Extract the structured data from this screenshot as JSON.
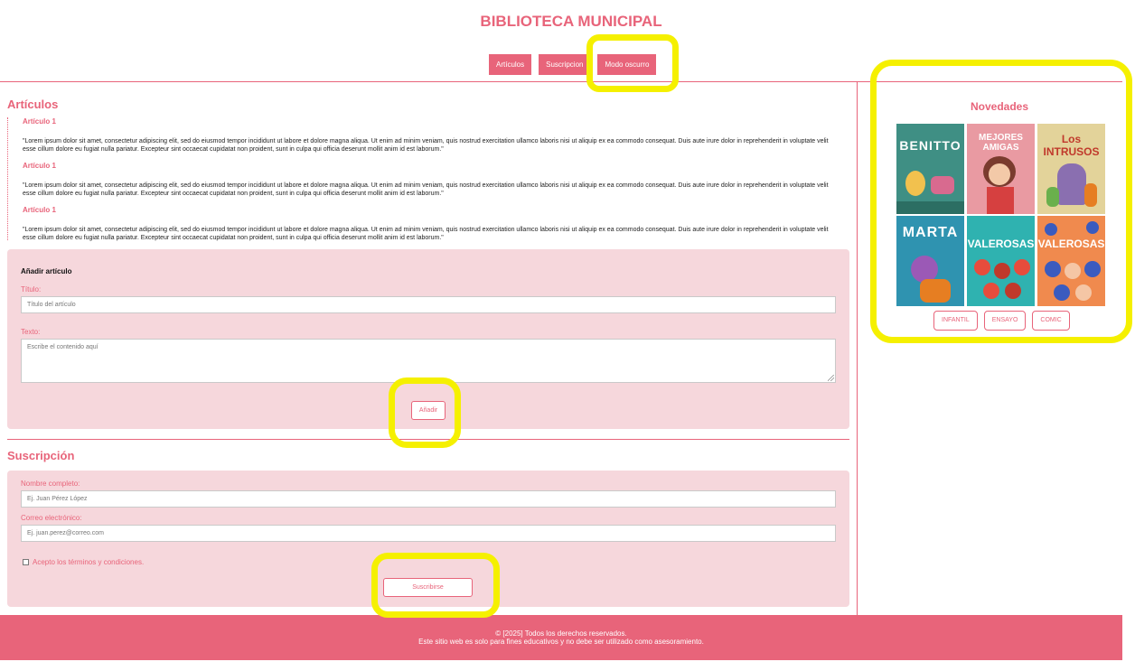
{
  "header": {
    "title": "BIBLIOTECA MUNICIPAL",
    "nav": [
      "Artículos",
      "Suscripcion",
      "Modo oscurro"
    ]
  },
  "articles": {
    "title": "Artículos",
    "items": [
      {
        "title": "Artículo 1",
        "text": "\"Lorem ipsum dolor sit amet, consectetur adipiscing elit, sed do eiusmod tempor incididunt ut labore et dolore magna aliqua. Ut enim ad minim veniam, quis nostrud exercitation ullamco laboris nisi ut aliquip ex ea commodo consequat. Duis aute irure dolor in reprehenderit in voluptate velit esse cillum dolore eu fugiat nulla pariatur. Excepteur sint occaecat cupidatat non proident, sunt in culpa qui officia deserunt mollit anim id est laborum.\""
      },
      {
        "title": "Artículo 1",
        "text": "\"Lorem ipsum dolor sit amet, consectetur adipiscing elit, sed do eiusmod tempor incididunt ut labore et dolore magna aliqua. Ut enim ad minim veniam, quis nostrud exercitation ullamco laboris nisi ut aliquip ex ea commodo consequat. Duis aute irure dolor in reprehenderit in voluptate velit esse cillum dolore eu fugiat nulla pariatur. Excepteur sint occaecat cupidatat non proident, sunt in culpa qui officia deserunt mollit anim id est laborum.\""
      },
      {
        "title": "Artículo 1",
        "text": "\"Lorem ipsum dolor sit amet, consectetur adipiscing elit, sed do eiusmod tempor incididunt ut labore et dolore magna aliqua. Ut enim ad minim veniam, quis nostrud exercitation ullamco laboris nisi ut aliquip ex ea commodo consequat. Duis aute irure dolor in reprehenderit in voluptate velit esse cillum dolore eu fugiat nulla pariatur. Excepteur sint occaecat cupidatat non proident, sunt in culpa qui officia deserunt mollit anim id est laborum.\""
      }
    ]
  },
  "add_article": {
    "heading": "Añadir artículo",
    "title_label": "Título:",
    "title_placeholder": "Título del artículo",
    "text_label": "Texto:",
    "text_placeholder": "Escribe el contenido aquí",
    "submit": "Añadir"
  },
  "subscription": {
    "title": "Suscripción",
    "name_label": "Nombre completo:",
    "name_placeholder": "Ej. Juan Pérez López",
    "email_label": "Correo electrónico:",
    "email_placeholder": "Ej. juan.perez@correo.com",
    "terms": "Acepto los términos y condiciones.",
    "terms_checked": false,
    "submit": "Suscribirse"
  },
  "sidebar": {
    "title": "Novedades",
    "covers": [
      {
        "title": "BENITTO",
        "bg": "#3f8f84"
      },
      {
        "title": "MEJORES AMIGAS",
        "bg": "#e99aa2"
      },
      {
        "title": "Los INTRUSOS",
        "bg": "#e3d39a"
      },
      {
        "title": "MARTA",
        "bg": "#2f93b0"
      },
      {
        "title": "VALEROSAS",
        "bg": "#2fb2b0"
      },
      {
        "title": "VALEROSAS",
        "bg": "#f08a4e"
      }
    ],
    "categories": [
      "INFANTIL",
      "ENSAYO",
      "COMIC"
    ]
  },
  "footer": {
    "line1": "© [2025] Todos los derechos reservados.",
    "line2": "Este sitio web es solo para fines educativos y no debe ser utilizado como asesoramiento."
  },
  "colors": {
    "accent": "#e8647a",
    "panel": "#f6d7dc",
    "highlight": "#f5f000"
  }
}
